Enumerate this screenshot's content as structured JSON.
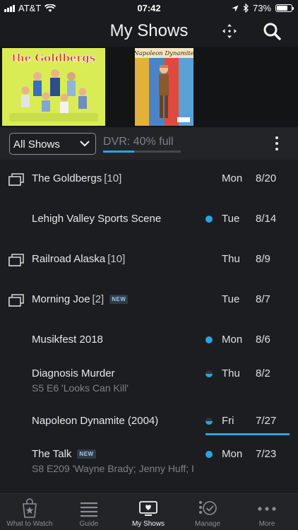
{
  "status_bar": {
    "carrier": "AT&T",
    "time": "07:42",
    "battery": "73%",
    "battery_level": 0.73
  },
  "header": {
    "title": "My Shows"
  },
  "posters": [
    {
      "title": "the Goldbergs"
    },
    {
      "title": "Napoleon Dynamite"
    }
  ],
  "filter": {
    "selected": "All Shows",
    "dvr_text": "DVR: 40% full",
    "dvr_level": 0.4
  },
  "rows": [
    {
      "title": "The Goldbergs",
      "count": "[10]",
      "badge": "",
      "subtitle": "",
      "dot": "",
      "day": "Mon",
      "date": "8/20",
      "stack": true
    },
    {
      "title": "Lehigh Valley Sports Scene",
      "count": "",
      "badge": "",
      "subtitle": "",
      "dot": "full",
      "day": "Tue",
      "date": "8/14",
      "stack": false
    },
    {
      "title": "Railroad Alaska",
      "count": "[10]",
      "badge": "",
      "subtitle": "",
      "dot": "",
      "day": "Thu",
      "date": "8/9",
      "stack": true
    },
    {
      "title": "Morning Joe",
      "count": "[2]",
      "badge": "NEW",
      "subtitle": "",
      "dot": "",
      "day": "Tue",
      "date": "8/7",
      "stack": true
    },
    {
      "title": "Musikfest 2018",
      "count": "",
      "badge": "",
      "subtitle": "",
      "dot": "full",
      "day": "Mon",
      "date": "8/6",
      "stack": false
    },
    {
      "title": "Diagnosis Murder",
      "count": "",
      "badge": "",
      "subtitle": "S5 E6 'Looks Can Kill'",
      "dot": "half",
      "day": "Thu",
      "date": "8/2",
      "stack": false
    },
    {
      "title": "Napoleon Dynamite (2004)",
      "count": "",
      "badge": "",
      "subtitle": "",
      "dot": "half",
      "day": "Fri",
      "date": "7/27",
      "stack": false,
      "progress": true
    },
    {
      "title": "The Talk",
      "count": "",
      "badge": "NEW",
      "subtitle": "S8 E209 'Wayne Brady; Jenny Huff; I",
      "dot": "full",
      "day": "Mon",
      "date": "7/23",
      "stack": false
    }
  ],
  "tabs": [
    {
      "label": "What to Watch",
      "icon": "star-bag-icon"
    },
    {
      "label": "Guide",
      "icon": "list-icon"
    },
    {
      "label": "My Shows",
      "icon": "heart-tv-icon",
      "active": true
    },
    {
      "label": "Manage",
      "icon": "manage-icon"
    },
    {
      "label": "More",
      "icon": "more-dots-icon"
    }
  ],
  "colors": {
    "accent": "#2ba3e3",
    "background": "#1c1d20"
  }
}
